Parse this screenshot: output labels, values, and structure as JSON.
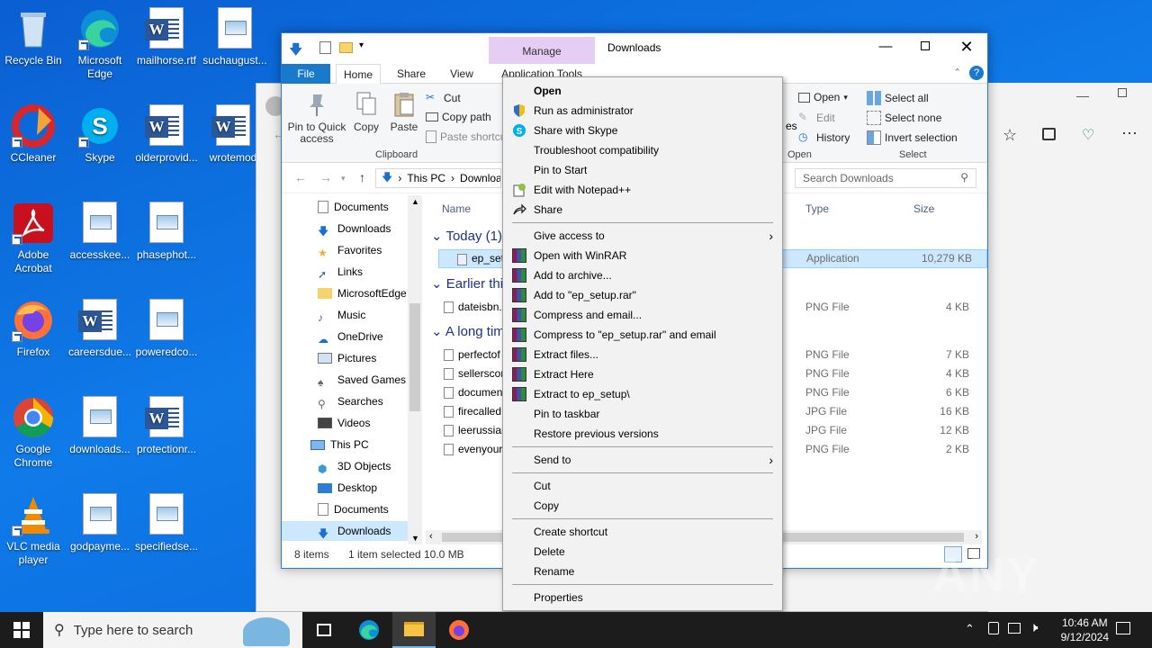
{
  "desktop": {
    "icons": [
      {
        "label": "Recycle Bin"
      },
      {
        "label": "Microsoft Edge"
      },
      {
        "label": "mailhorse.rtf"
      },
      {
        "label": "suchaugust..."
      },
      {
        "label": "CCleaner"
      },
      {
        "label": "Skype"
      },
      {
        "label": "olderprovid..."
      },
      {
        "label": "wrotemod"
      },
      {
        "label": "Adobe Acrobat"
      },
      {
        "label": "accesskee..."
      },
      {
        "label": "phasephot..."
      },
      {
        "label": "Firefox"
      },
      {
        "label": "careersdue..."
      },
      {
        "label": "poweredco..."
      },
      {
        "label": "Google Chrome"
      },
      {
        "label": "downloads..."
      },
      {
        "label": "protectionr..."
      },
      {
        "label": "VLC media player"
      },
      {
        "label": "godpayme..."
      },
      {
        "label": "specifiedse..."
      }
    ]
  },
  "explorer": {
    "title": "Downloads",
    "manage_tab": "Manage",
    "tabs": {
      "file": "File",
      "home": "Home",
      "share": "Share",
      "view": "View",
      "app_tools": "Application Tools"
    },
    "ribbon": {
      "pin": "Pin to Quick access",
      "copy": "Copy",
      "paste": "Paste",
      "cut": "Cut",
      "copy_path": "Copy path",
      "paste_shortcut": "Paste shortcut",
      "clipboard_label": "Clipboard",
      "open": "Open",
      "edit": "Edit",
      "history": "History",
      "open_label": "Open",
      "es_fragment": "es",
      "select_all": "Select all",
      "select_none": "Select none",
      "invert_selection": "Invert selection",
      "select_label": "Select"
    },
    "address": {
      "this_pc": "This PC",
      "downloads": "Downloads"
    },
    "search_placeholder": "Search Downloads",
    "nav": [
      {
        "label": "Documents"
      },
      {
        "label": "Downloads"
      },
      {
        "label": "Favorites"
      },
      {
        "label": "Links"
      },
      {
        "label": "MicrosoftEdge"
      },
      {
        "label": "Music"
      },
      {
        "label": "OneDrive"
      },
      {
        "label": "Pictures"
      },
      {
        "label": "Saved Games"
      },
      {
        "label": "Searches"
      },
      {
        "label": "Videos"
      },
      {
        "label": "This PC"
      },
      {
        "label": "3D Objects"
      },
      {
        "label": "Desktop"
      },
      {
        "label": "Documents"
      },
      {
        "label": "Downloads"
      }
    ],
    "columns": {
      "name": "Name",
      "type": "Type",
      "size": "Size"
    },
    "groups": {
      "today": "Today (1)",
      "earlier": "Earlier thi",
      "long": "A long tim"
    },
    "files": [
      {
        "name": "ep_setup",
        "type": "Application",
        "size": "10,279 KB"
      },
      {
        "name": "dateisbn...",
        "type": "PNG File",
        "size": "4 KB"
      },
      {
        "name": "perfectof",
        "type": "PNG File",
        "size": "7 KB"
      },
      {
        "name": "sellerscor",
        "type": "PNG File",
        "size": "4 KB"
      },
      {
        "name": "documen",
        "type": "PNG File",
        "size": "6 KB"
      },
      {
        "name": "firecalled",
        "type": "JPG File",
        "size": "16 KB"
      },
      {
        "name": "leerussian",
        "type": "JPG File",
        "size": "12 KB"
      },
      {
        "name": "evenyour",
        "type": "PNG File",
        "size": "2 KB"
      }
    ],
    "status": {
      "items": "8 items",
      "selected": "1 item selected",
      "size": "10.0 MB"
    }
  },
  "context_menu": {
    "items": [
      "Open",
      "Run as administrator",
      "Share with Skype",
      "Troubleshoot compatibility",
      "Pin to Start",
      "Edit with Notepad++",
      "Share",
      "Give access to",
      "Open with WinRAR",
      "Add to archive...",
      "Add to \"ep_setup.rar\"",
      "Compress and email...",
      "Compress to \"ep_setup.rar\" and email",
      "Extract files...",
      "Extract Here",
      "Extract to ep_setup\\",
      "Pin to taskbar",
      "Restore previous versions",
      "Send to",
      "Cut",
      "Copy",
      "Create shortcut",
      "Delete",
      "Rename",
      "Properties"
    ]
  },
  "taskbar": {
    "search_placeholder": "Type here to search",
    "time": "10:46 AM",
    "date": "9/12/2024"
  },
  "watermark": "ANY RUN",
  "colors": {
    "accent": "#1979ca",
    "selection": "#cce8ff",
    "taskbar": "#1c1c1c"
  }
}
